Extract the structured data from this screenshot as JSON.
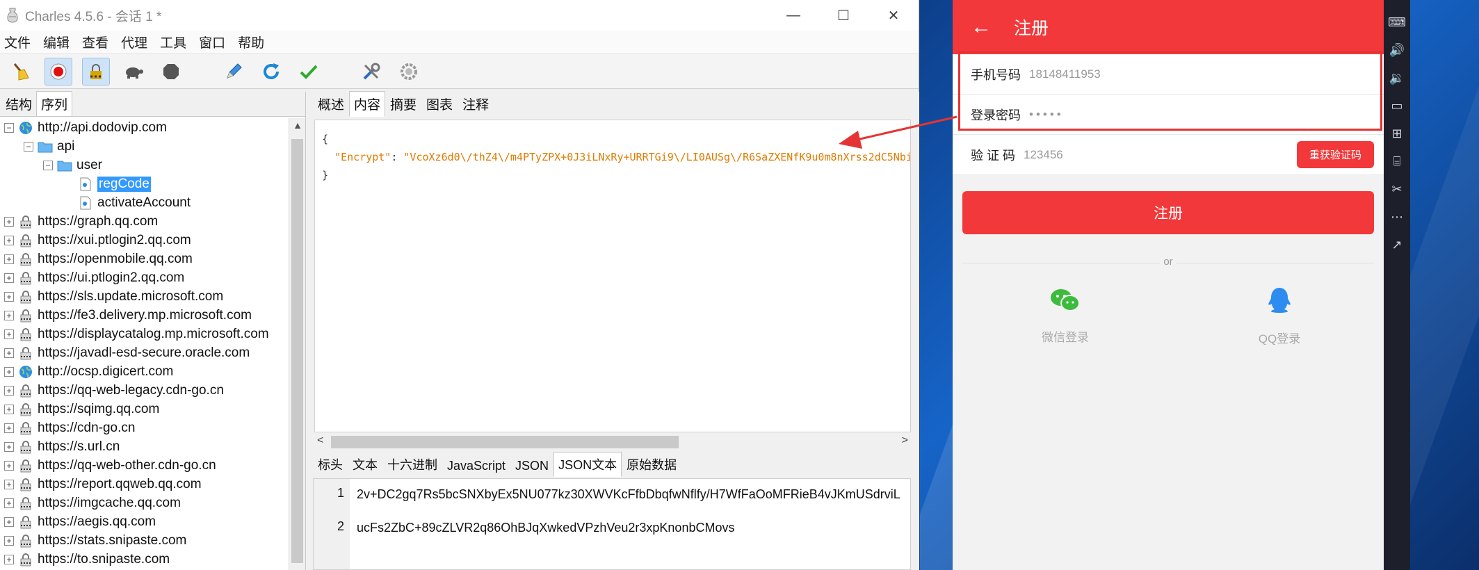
{
  "window": {
    "title": "Charles 4.5.6 - 会话 1 *"
  },
  "menu": [
    "文件",
    "编辑",
    "查看",
    "代理",
    "工具",
    "窗口",
    "帮助"
  ],
  "toolbar_icons": [
    "broom-icon",
    "record-icon",
    "ssl-lock-icon",
    "turtle-icon",
    "stop-icon",
    "pen-icon",
    "refresh-icon",
    "check-icon",
    "tools-icon",
    "gear-icon"
  ],
  "left_tabs": [
    "结构",
    "序列"
  ],
  "tree": [
    {
      "label": "http://api.dodovip.com",
      "level": 0,
      "icon": "globe",
      "exp": "−"
    },
    {
      "label": "api",
      "level": 1,
      "icon": "folder",
      "exp": "−"
    },
    {
      "label": "user",
      "level": 2,
      "icon": "folder",
      "exp": "−"
    },
    {
      "label": "regCode",
      "level": 3,
      "icon": "file",
      "exp": "",
      "selected": true
    },
    {
      "label": "activateAccount",
      "level": 3,
      "icon": "file",
      "exp": ""
    },
    {
      "label": "https://graph.qq.com",
      "level": 0,
      "icon": "lock",
      "exp": "+"
    },
    {
      "label": "https://xui.ptlogin2.qq.com",
      "level": 0,
      "icon": "lock",
      "exp": "+"
    },
    {
      "label": "https://openmobile.qq.com",
      "level": 0,
      "icon": "lock",
      "exp": "+"
    },
    {
      "label": "https://ui.ptlogin2.qq.com",
      "level": 0,
      "icon": "lock",
      "exp": "+"
    },
    {
      "label": "https://sls.update.microsoft.com",
      "level": 0,
      "icon": "lock",
      "exp": "+"
    },
    {
      "label": "https://fe3.delivery.mp.microsoft.com",
      "level": 0,
      "icon": "lock",
      "exp": "+"
    },
    {
      "label": "https://displaycatalog.mp.microsoft.com",
      "level": 0,
      "icon": "lock",
      "exp": "+"
    },
    {
      "label": "https://javadl-esd-secure.oracle.com",
      "level": 0,
      "icon": "lock",
      "exp": "+"
    },
    {
      "label": "http://ocsp.digicert.com",
      "level": 0,
      "icon": "globe",
      "exp": "+"
    },
    {
      "label": "https://qq-web-legacy.cdn-go.cn",
      "level": 0,
      "icon": "lock",
      "exp": "+"
    },
    {
      "label": "https://sqimg.qq.com",
      "level": 0,
      "icon": "lock",
      "exp": "+"
    },
    {
      "label": "https://cdn-go.cn",
      "level": 0,
      "icon": "lock",
      "exp": "+"
    },
    {
      "label": "https://s.url.cn",
      "level": 0,
      "icon": "lock",
      "exp": "+"
    },
    {
      "label": "https://qq-web-other.cdn-go.cn",
      "level": 0,
      "icon": "lock",
      "exp": "+"
    },
    {
      "label": "https://report.qqweb.qq.com",
      "level": 0,
      "icon": "lock",
      "exp": "+"
    },
    {
      "label": "https://imgcache.qq.com",
      "level": 0,
      "icon": "lock",
      "exp": "+"
    },
    {
      "label": "https://aegis.qq.com",
      "level": 0,
      "icon": "lock",
      "exp": "+"
    },
    {
      "label": "https://stats.snipaste.com",
      "level": 0,
      "icon": "lock",
      "exp": "+"
    },
    {
      "label": "https://to.snipaste.com",
      "level": 0,
      "icon": "lock",
      "exp": "+"
    }
  ],
  "right_tabs": [
    "概述",
    "内容",
    "摘要",
    "图表",
    "注释"
  ],
  "right_tab_selected": 1,
  "json_view": {
    "open": "{",
    "key": "\"Encrypt\"",
    "colon": ": ",
    "value": "\"VcoXz6d0\\/thZ4\\/m4PTyZPX+0J3iLNxRy+URRTGi9\\/LI0AUSg\\/R6SaZXENfK9u0m8nXrss2dC5Nbi",
    "close": "}"
  },
  "bottom_tabs": [
    "标头",
    "文本",
    "十六进制",
    "JavaScript",
    "JSON",
    "JSON文本",
    "原始数据"
  ],
  "bottom_tab_selected": 5,
  "text_lines": [
    {
      "num": "1",
      "text": "2v+DC2gq7Rs5bcSNXbyEx5NU077kz30XWVKcFfbDbqfwNflfy/H7WfFaOoMFRieB4vJKmUSdrviL"
    },
    {
      "num": "2",
      "text": "ucFs2ZbC+89cZLVR2q86OhBJqXwkedVPzhVeu2r3xpKnonbCMovs"
    }
  ],
  "phone": {
    "title": "注册",
    "phone_label": "手机号码",
    "phone_value": "18148411953",
    "password_label": "登录密码",
    "password_value": "•••••",
    "code_label": "验 证 码",
    "code_value": "123456",
    "resend_label": "重获验证码",
    "register_label": "注册",
    "or_text": "or",
    "wechat_label": "微信登录",
    "qq_label": "QQ登录"
  },
  "colors": {
    "accent_red": "#f2383a",
    "json_orange": "#e07b00",
    "selection_blue": "#3399ff",
    "wechat_green": "#3dbb3d",
    "qq_blue": "#2d8cf0"
  }
}
